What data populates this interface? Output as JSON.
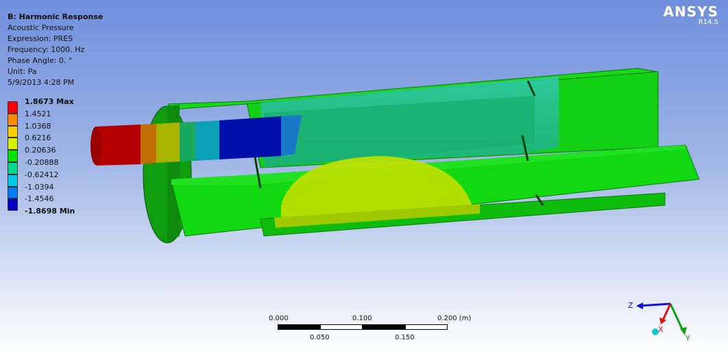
{
  "info": {
    "title": "B: Harmonic Response",
    "result": "Acoustic Pressure",
    "expression": "Expression: PRES",
    "frequency": "Frequency: 1000. Hz",
    "phase": "Phase Angle: 0. °",
    "unit": "Unit: Pa",
    "date": "5/9/2013 4:28 PM"
  },
  "brand": {
    "name": "ANSYS",
    "version": "R14.5"
  },
  "legend": {
    "max_label": "1.8673 Max",
    "min_label": "-1.8698 Min",
    "labels": [
      "1.4521",
      "1.0368",
      "0.6216",
      "0.20636",
      "-0.20888",
      "-0.62412",
      "-1.0394",
      "-1.4546"
    ],
    "colors": [
      "#ff0000",
      "#ff8c00",
      "#ffd000",
      "#d6f000",
      "#00e400",
      "#00d890",
      "#00c8e8",
      "#007cff",
      "#0000c8"
    ]
  },
  "scale": {
    "ticks_top": [
      "0.000",
      "0.100",
      "0.200 (m)"
    ],
    "ticks_bottom": [
      "0.050",
      "0.150"
    ]
  },
  "triad": {
    "z": "Z",
    "x": "X",
    "y": "Y"
  }
}
